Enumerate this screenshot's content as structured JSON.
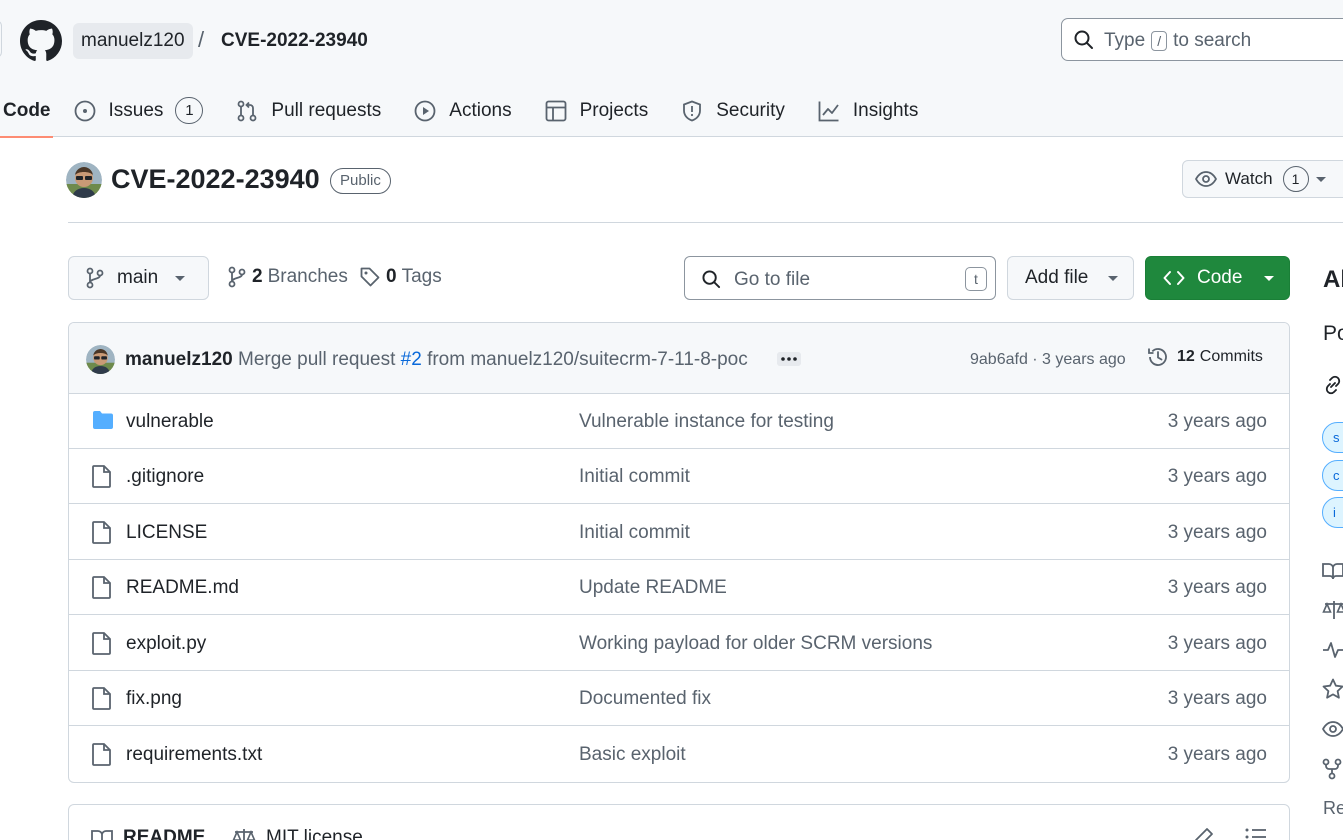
{
  "header": {
    "owner": "manuelz120",
    "separator": "/",
    "repo": "CVE-2022-23940",
    "search": {
      "prefix": "Type",
      "key": "/",
      "suffix": "to search"
    }
  },
  "nav": {
    "code": "Code",
    "issues": "Issues",
    "issues_count": "1",
    "pulls": "Pull requests",
    "actions": "Actions",
    "projects": "Projects",
    "security": "Security",
    "insights": "Insights"
  },
  "repo": {
    "name": "CVE-2022-23940",
    "visibility": "Public",
    "watch_label": "Watch",
    "watch_count": "1"
  },
  "toolbar": {
    "branch": "main",
    "branches_count": "2",
    "branches_label": "Branches",
    "tags_count": "0",
    "tags_label": "Tags",
    "goto_placeholder": "Go to file",
    "goto_key": "t",
    "add_file": "Add file",
    "code": "Code"
  },
  "latest_commit": {
    "author": "manuelz120",
    "message_prefix": "Merge pull request",
    "pr_ref": "#2",
    "message_suffix": "from manuelz120/suitecrm-7-11-8-poc",
    "meta": "9ab6afd · 3 years ago",
    "commits_count": "12",
    "commits_label": "Commits"
  },
  "files": [
    {
      "name": "vulnerable",
      "type": "dir",
      "icon": "folder-icon",
      "commit": "Vulnerable instance for testing",
      "age": "3 years ago"
    },
    {
      "name": ".gitignore",
      "type": "file",
      "icon": "file-icon",
      "commit": "Initial commit",
      "age": "3 years ago"
    },
    {
      "name": "LICENSE",
      "type": "file",
      "icon": "file-icon",
      "commit": "Initial commit",
      "age": "3 years ago"
    },
    {
      "name": "README.md",
      "type": "file",
      "icon": "file-icon",
      "commit": "Update README",
      "age": "3 years ago"
    },
    {
      "name": "exploit.py",
      "type": "file",
      "icon": "file-icon",
      "commit": "Working payload for older SCRM versions",
      "age": "3 years ago"
    },
    {
      "name": "fix.png",
      "type": "file",
      "icon": "file-icon",
      "commit": "Documented fix",
      "age": "3 years ago"
    },
    {
      "name": "requirements.txt",
      "type": "file",
      "icon": "file-icon",
      "commit": "Basic exploit",
      "age": "3 years ago"
    }
  ],
  "readme_tabs": {
    "readme": "README",
    "license": "MIT license"
  },
  "sidebar": {
    "about_partial": "Ab",
    "desc_partial": "Po",
    "topic_initials": [
      "s",
      "c",
      "i"
    ],
    "footer_partial": "Re"
  },
  "colors": {
    "accent_green": "#1f883d",
    "link_blue": "#0969da",
    "folder_blue": "#54aeff",
    "tab_underline": "#fd8c73"
  }
}
